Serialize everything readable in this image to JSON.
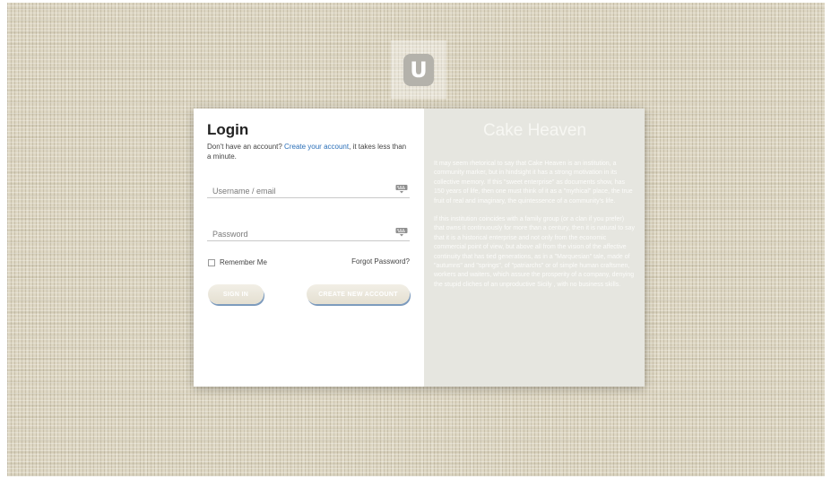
{
  "logo": {
    "letter": "U"
  },
  "login": {
    "title": "Login",
    "signup_prefix": "Don't have an account?",
    "signup_link": "Create your account",
    "signup_suffix": ", it takes less than a minute.",
    "username_placeholder": "Username / email",
    "password_placeholder": "Password",
    "remember_label": "Remember Me",
    "forgot_label": "Forgot Password?",
    "signin_label": "SIGN IN",
    "create_label": "CREATE NEW ACCOUNT"
  },
  "info": {
    "title": "Cake Heaven",
    "paragraph1": "It may seem rhetorical to say that Cake Heaven is an institution, a community marker, but in hindsight it has a strong motivation in its collective memory. If this \"sweet enterprise\" as documents show, has 150 years of life, then one must think of it as a \"mythical\" place, the true fruit of real and imaginary, the quintessence of a community's life.",
    "paragraph2": "If this institution coincides with a family group (or a clan if you prefer) that owns it continuously for more than a century, then it is natural to say that it is a historical enterprise and not only from the economic commercial point of view, but above all from the vision of the affective continuity that has tied generations, as in a \"Marquesian\" tale, made of \"autumns\" and \"springs\", of \"patriarchs\" or of simple human craftsmen, workers and waiters, which assure the prosperity of a company, denying the stupid cliches of an unproductive Sicily , with no business skills."
  },
  "colors": {
    "link": "#2a6fb8",
    "button_shadow": "#7d9bbd",
    "panel_bg": "#e6e6e0",
    "backdrop": "#ddd6c2"
  },
  "icons": {
    "field_icon": "keyboard-icon",
    "logo_icon": "u-logo-icon"
  }
}
